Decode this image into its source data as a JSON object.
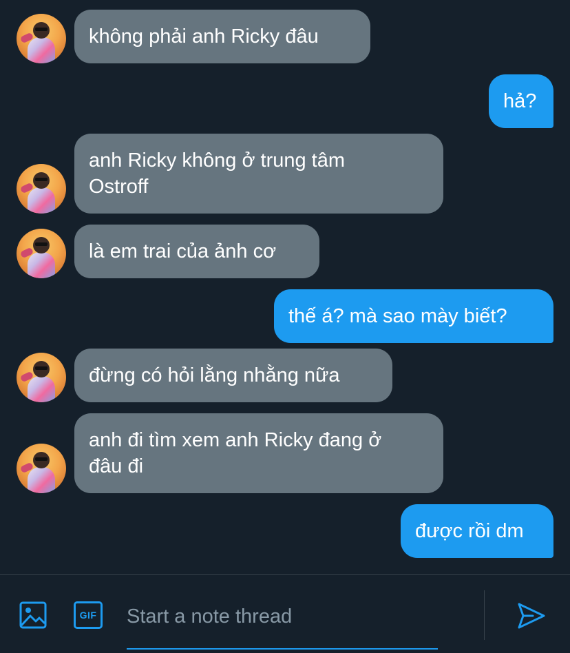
{
  "messages": [
    {
      "side": "in",
      "lines": [
        "không phải anh Ricky đâu"
      ]
    },
    {
      "side": "out",
      "lines": [
        "hả?"
      ]
    },
    {
      "side": "in",
      "lines": [
        "anh Ricky không ở trung tâm",
        "Ostroff"
      ]
    },
    {
      "side": "in",
      "lines": [
        "là em trai của ảnh cơ"
      ]
    },
    {
      "side": "out",
      "lines": [
        "thế á? mà sao mày biết?"
      ]
    },
    {
      "side": "in",
      "lines": [
        "đừng có hỏi lằng nhằng nữa"
      ]
    },
    {
      "side": "in",
      "lines": [
        "anh đi tìm xem anh Ricky đang ở",
        "đâu đi"
      ]
    },
    {
      "side": "out",
      "lines": [
        "được rồi dm"
      ]
    }
  ],
  "composer": {
    "placeholder": "Start a note thread",
    "image_icon": "image-icon",
    "gif_icon": "gif-icon",
    "gif_label": "GIF",
    "send_icon": "send-icon"
  },
  "colors": {
    "background": "#15202b",
    "incoming_bubble": "#66757f",
    "outgoing_bubble": "#1d9bf0",
    "accent": "#1d9bf0",
    "placeholder": "#8899a6",
    "divider": "#38444d"
  }
}
